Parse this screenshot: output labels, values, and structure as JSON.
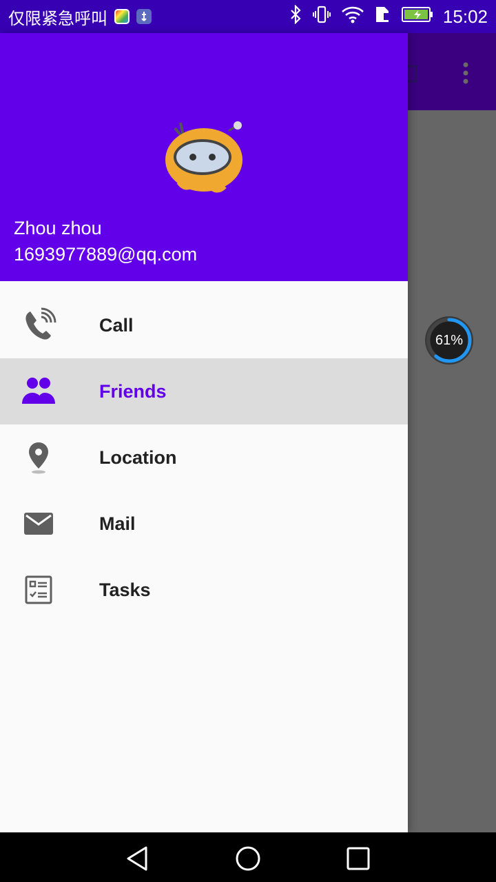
{
  "status_bar": {
    "carrier_text": "仅限紧急呼叫",
    "time": "15:02",
    "icons": [
      "colorful-app-icon",
      "usb-icon",
      "bluetooth-icon",
      "vibrate-icon",
      "wifi-icon",
      "sim-icon",
      "battery-charging-icon"
    ]
  },
  "overlay": {
    "progress_percent_label": "61%",
    "progress_value": 61
  },
  "drawer": {
    "header": {
      "name": "Zhou zhou",
      "email": "1693977889@qq.com",
      "avatar_icon": "mascot-avatar-icon"
    },
    "menu": [
      {
        "label": "Call",
        "icon": "phone-call-icon",
        "selected": false
      },
      {
        "label": "Friends",
        "icon": "people-icon",
        "selected": true
      },
      {
        "label": "Location",
        "icon": "location-pin-icon",
        "selected": false
      },
      {
        "label": "Mail",
        "icon": "mail-icon",
        "selected": false
      },
      {
        "label": "Tasks",
        "icon": "task-list-icon",
        "selected": false
      }
    ]
  },
  "colors": {
    "primary": "#6200ea",
    "primary_dark": "#3700b3",
    "selected_bg": "#dcdcdc",
    "scrim": "#666666",
    "progress_ring": "#2196f3"
  },
  "nav_bar": {
    "buttons": [
      "back-icon",
      "home-icon",
      "recents-icon"
    ]
  }
}
